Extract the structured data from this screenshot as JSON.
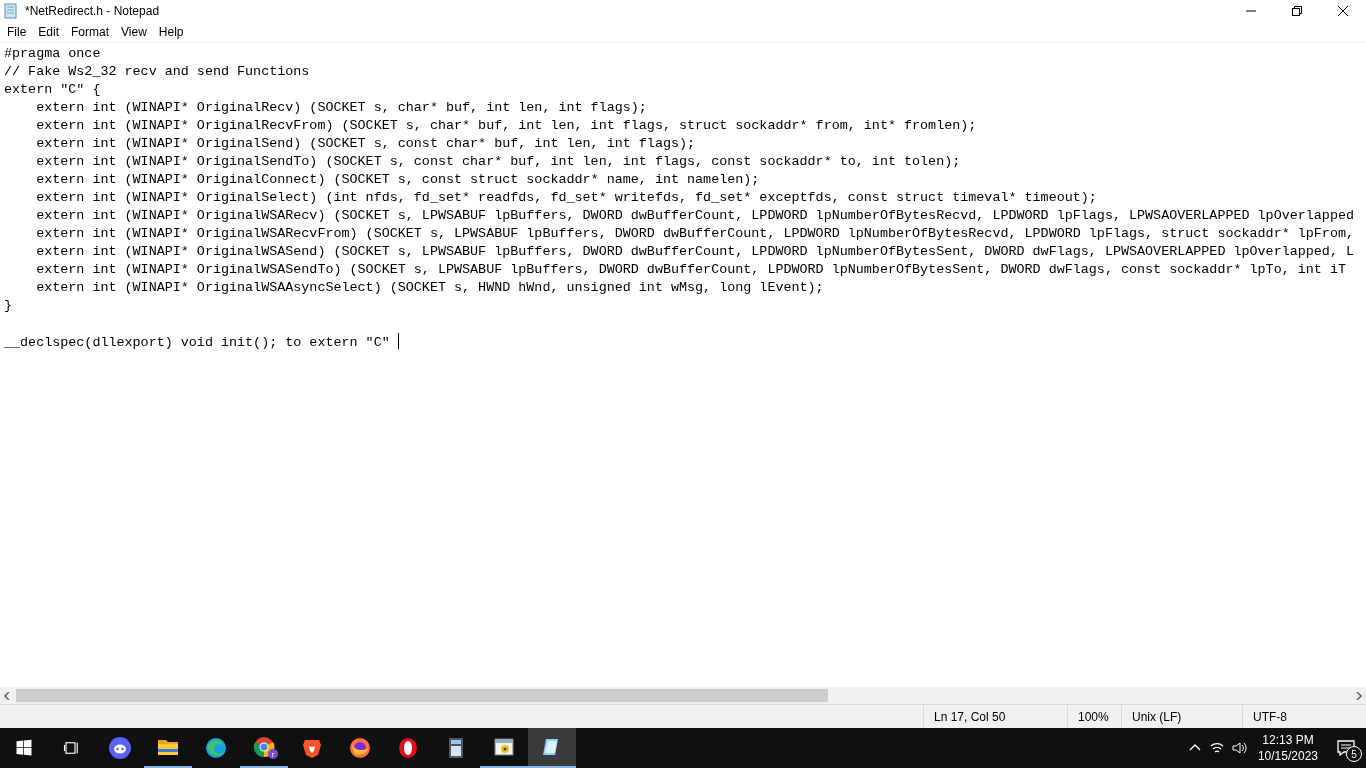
{
  "window": {
    "title": "*NetRedirect.h - Notepad"
  },
  "menu": [
    "File",
    "Edit",
    "Format",
    "View",
    "Help"
  ],
  "editor": {
    "lines": [
      {
        "kind": "code",
        "text": "#pragma once"
      },
      {
        "kind": "code",
        "text": "// Fake Ws2_32 recv and send Functions"
      },
      {
        "kind": "code",
        "text": "extern \"C\" {"
      },
      {
        "kind": "code",
        "text": "    extern int (WINAPI* OriginalRecv) (SOCKET s, char* buf, int len, int flags);"
      },
      {
        "kind": "code",
        "text": "    extern int (WINAPI* OriginalRecvFrom) (SOCKET s, char* buf, int len, int flags, struct sockaddr* from, int* fromlen);"
      },
      {
        "kind": "code",
        "text": "    extern int (WINAPI* OriginalSend) (SOCKET s, const char* buf, int len, int flags);"
      },
      {
        "kind": "code",
        "text": "    extern int (WINAPI* OriginalSendTo) (SOCKET s, const char* buf, int len, int flags, const sockaddr* to, int tolen);"
      },
      {
        "kind": "code",
        "text": "    extern int (WINAPI* OriginalConnect) (SOCKET s, const struct sockaddr* name, int namelen);"
      },
      {
        "kind": "code",
        "text": "    extern int (WINAPI* OriginalSelect) (int nfds, fd_set* readfds, fd_set* writefds, fd_set* exceptfds, const struct timeval* timeout);"
      },
      {
        "kind": "code",
        "text": "    extern int (WINAPI* OriginalWSARecv) (SOCKET s, LPWSABUF lpBuffers, DWORD dwBufferCount, LPDWORD lpNumberOfBytesRecvd, LPDWORD lpFlags, LPWSAOVERLAPPED lpOverlapped"
      },
      {
        "kind": "code",
        "text": "    extern int (WINAPI* OriginalWSARecvFrom) (SOCKET s, LPWSABUF lpBuffers, DWORD dwBufferCount, LPDWORD lpNumberOfBytesRecvd, LPDWORD lpFlags, struct sockaddr* lpFrom,"
      },
      {
        "kind": "code",
        "text": "    extern int (WINAPI* OriginalWSASend) (SOCKET s, LPWSABUF lpBuffers, DWORD dwBufferCount, LPDWORD lpNumberOfBytesSent, DWORD dwFlags, LPWSAOVERLAPPED lpOverlapped, L"
      },
      {
        "kind": "code",
        "text": "    extern int (WINAPI* OriginalWSASendTo) (SOCKET s, LPWSABUF lpBuffers, DWORD dwBufferCount, LPDWORD lpNumberOfBytesSent, DWORD dwFlags, const sockaddr* lpTo, int iT"
      },
      {
        "kind": "code",
        "text": "    extern int (WINAPI* OriginalWSAAsyncSelect) (SOCKET s, HWND hWnd, unsigned int wMsg, long lEvent);"
      },
      {
        "kind": "code",
        "text": "}"
      },
      {
        "kind": "blank"
      },
      {
        "kind": "code",
        "text": "__declspec(dllexport) void init(); to extern \"C\" "
      }
    ]
  },
  "status_bar": {
    "position": "Ln 17, Col 50",
    "zoom": "100%",
    "line_ending": "Unix (LF)",
    "encoding": "UTF-8"
  },
  "taskbar": {
    "apps": [
      {
        "kind": "discord",
        "running": false,
        "selected": false
      },
      {
        "kind": "folder",
        "running": true,
        "selected": false
      },
      {
        "kind": "edge",
        "running": false,
        "selected": false
      },
      {
        "kind": "chrome",
        "running": true,
        "selected": false,
        "badge": "r"
      },
      {
        "kind": "brave",
        "running": false,
        "selected": false
      },
      {
        "kind": "firefox",
        "running": false,
        "selected": false
      },
      {
        "kind": "opera",
        "running": false,
        "selected": false
      },
      {
        "kind": "calculator",
        "running": false,
        "selected": false
      },
      {
        "kind": "window",
        "running": true,
        "selected": false
      },
      {
        "kind": "notepad",
        "running": true,
        "selected": true
      }
    ],
    "time": "12:13 PM",
    "date": "10/15/2023",
    "notifications": "5"
  }
}
